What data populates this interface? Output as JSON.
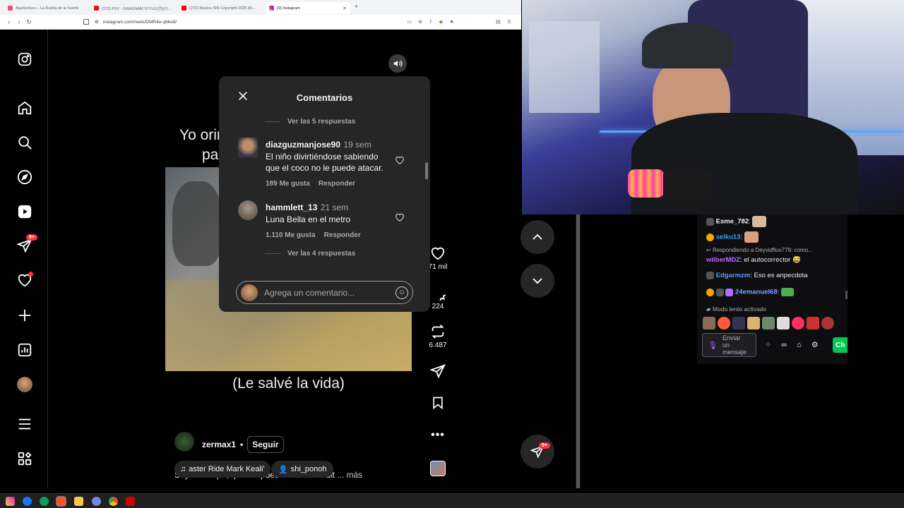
{
  "browser": {
    "tabs": [
      {
        "label": "AppSorteos – La Ruleta de la Suerte",
        "color": "#e94e77"
      },
      {
        "label": "(272) PSY - GANGNAM STYLE(강남스...",
        "color": "#ff0000"
      },
      {
        "label": "(272) Musica SIN Copyright 2025 [Ki...",
        "color": "#ff0000"
      },
      {
        "label": "(9) Instagram",
        "color": "#d6249f"
      }
    ],
    "new_tab": "+",
    "url": "instagram.com/reels/DMR4e-qMedt/"
  },
  "reel": {
    "overlay_text_top_line1": "Yo orin",
    "overlay_text_top_line2": "par",
    "overlay_caption": "(Le salvé la vida)",
    "author": "zermax1",
    "dot": "•",
    "follow_label": "Seguir",
    "description": "Soy filántropo, qué les puedo decir? Crédit",
    "more_label": "... más",
    "music_label": "aster Ride  Mark Keali'",
    "tagged_user": "shi_ponoh"
  },
  "actions": {
    "likes": "71 mil",
    "comments": "224",
    "reposts": "6.487"
  },
  "nav_badges": {
    "messages": "9+",
    "floating_messages": "9+"
  },
  "comments_modal": {
    "title": "Comentarios",
    "view_replies_top": "Ver las 5 respuestas",
    "comments": [
      {
        "user": "diazguzmanjose90",
        "time": "19 sem",
        "text": "El niño divirtiéndose sabiendo que el coco no le puede atacar.",
        "likes": "189 Me gusta",
        "reply": "Responder"
      },
      {
        "user": "hammlett_13",
        "time": "21 sem",
        "text": "Luna Bella en el metro",
        "likes": "1.110 Me gusta",
        "reply": "Responder"
      }
    ],
    "view_replies_bottom": "Ver las 4 respuestas",
    "input_placeholder": "Agrega un comentario..."
  },
  "chat": {
    "lines": [
      {
        "user": "Esme_782",
        "user_color": "#f5f5f5",
        "text": ""
      },
      {
        "user": "seiku13",
        "user_color": "#3aa3ff",
        "text": ""
      },
      {
        "reply_context": "Respondiendo a Deyvidfloo778: como..."
      },
      {
        "user": "wilberMDZ",
        "user_color": "#b46bff",
        "text": "el autocorrector 😅"
      },
      {
        "user": "Edgarmzm",
        "user_color": "#5b9bff",
        "text": "Eso es anpecdota"
      },
      {
        "user": "24emanuel68",
        "user_color": "#7aa0ff",
        "text": ""
      }
    ],
    "slow_mode": "Modo lento activado",
    "send_placeholder": "Enviar un mensaje",
    "chat_button": "Ch"
  }
}
